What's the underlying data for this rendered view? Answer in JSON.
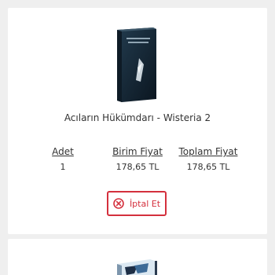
{
  "cart_item": {
    "title": "Acıların Hükümdarı - Wisteria 2",
    "columns": {
      "quantity_label": "Adet",
      "unit_price_label": "Birim Fiyat",
      "total_price_label": "Toplam Fiyat"
    },
    "values": {
      "quantity": "1",
      "unit_price": "178,65 TL",
      "total_price": "178,65 TL"
    },
    "cancel_button_label": "İptal Et",
    "cancel_icon": "x-circle-icon"
  },
  "colors": {
    "accent": "#d4303d"
  }
}
